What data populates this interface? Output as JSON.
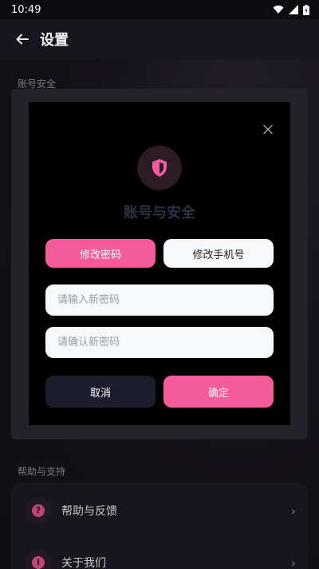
{
  "status_bar": {
    "time": "10:49"
  },
  "app_bar": {
    "title": "设置"
  },
  "sections": {
    "account_security": "账号安全",
    "help_support": "帮助与支持"
  },
  "help_items": [
    {
      "label": "帮助与反馈",
      "icon": "question-icon"
    },
    {
      "label": "关于我们",
      "icon": "info-icon"
    }
  ],
  "dialog": {
    "title": "账号与安全",
    "tabs": [
      {
        "label": "修改密码",
        "active": true
      },
      {
        "label": "修改手机号",
        "active": false
      }
    ],
    "new_password_placeholder": "请输入新密码",
    "confirm_password_placeholder": "请确认新密码",
    "cancel_label": "取消",
    "confirm_label": "确定"
  },
  "colors": {
    "accent": "#f35b9b",
    "dialog_bg": "#000000",
    "frame_bg": "#23222b"
  }
}
